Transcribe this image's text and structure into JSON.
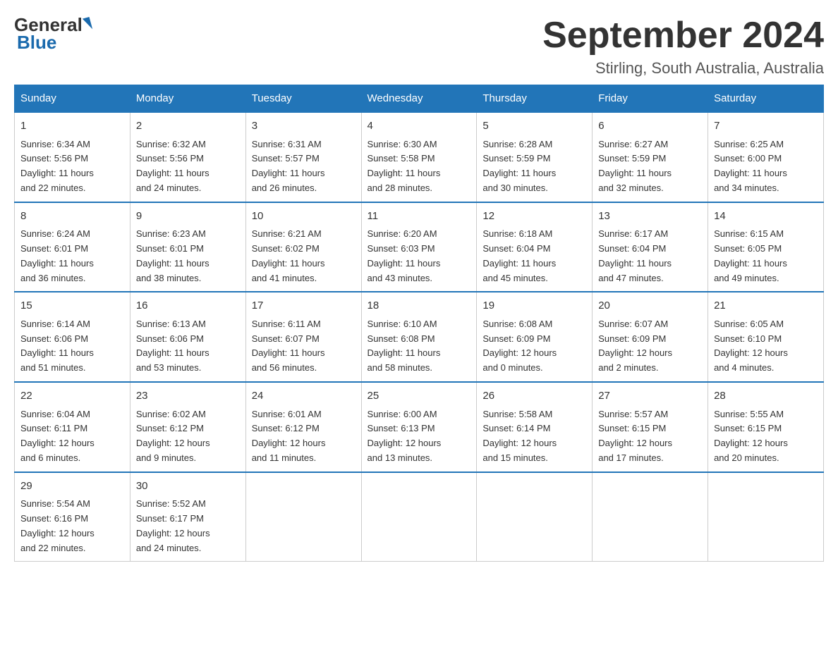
{
  "header": {
    "logo_general": "General",
    "logo_blue": "Blue",
    "month_year": "September 2024",
    "location": "Stirling, South Australia, Australia"
  },
  "days_of_week": [
    "Sunday",
    "Monday",
    "Tuesday",
    "Wednesday",
    "Thursday",
    "Friday",
    "Saturday"
  ],
  "weeks": [
    [
      {
        "day": "1",
        "sunrise": "6:34 AM",
        "sunset": "5:56 PM",
        "daylight": "11 hours and 22 minutes."
      },
      {
        "day": "2",
        "sunrise": "6:32 AM",
        "sunset": "5:56 PM",
        "daylight": "11 hours and 24 minutes."
      },
      {
        "day": "3",
        "sunrise": "6:31 AM",
        "sunset": "5:57 PM",
        "daylight": "11 hours and 26 minutes."
      },
      {
        "day": "4",
        "sunrise": "6:30 AM",
        "sunset": "5:58 PM",
        "daylight": "11 hours and 28 minutes."
      },
      {
        "day": "5",
        "sunrise": "6:28 AM",
        "sunset": "5:59 PM",
        "daylight": "11 hours and 30 minutes."
      },
      {
        "day": "6",
        "sunrise": "6:27 AM",
        "sunset": "5:59 PM",
        "daylight": "11 hours and 32 minutes."
      },
      {
        "day": "7",
        "sunrise": "6:25 AM",
        "sunset": "6:00 PM",
        "daylight": "11 hours and 34 minutes."
      }
    ],
    [
      {
        "day": "8",
        "sunrise": "6:24 AM",
        "sunset": "6:01 PM",
        "daylight": "11 hours and 36 minutes."
      },
      {
        "day": "9",
        "sunrise": "6:23 AM",
        "sunset": "6:01 PM",
        "daylight": "11 hours and 38 minutes."
      },
      {
        "day": "10",
        "sunrise": "6:21 AM",
        "sunset": "6:02 PM",
        "daylight": "11 hours and 41 minutes."
      },
      {
        "day": "11",
        "sunrise": "6:20 AM",
        "sunset": "6:03 PM",
        "daylight": "11 hours and 43 minutes."
      },
      {
        "day": "12",
        "sunrise": "6:18 AM",
        "sunset": "6:04 PM",
        "daylight": "11 hours and 45 minutes."
      },
      {
        "day": "13",
        "sunrise": "6:17 AM",
        "sunset": "6:04 PM",
        "daylight": "11 hours and 47 minutes."
      },
      {
        "day": "14",
        "sunrise": "6:15 AM",
        "sunset": "6:05 PM",
        "daylight": "11 hours and 49 minutes."
      }
    ],
    [
      {
        "day": "15",
        "sunrise": "6:14 AM",
        "sunset": "6:06 PM",
        "daylight": "11 hours and 51 minutes."
      },
      {
        "day": "16",
        "sunrise": "6:13 AM",
        "sunset": "6:06 PM",
        "daylight": "11 hours and 53 minutes."
      },
      {
        "day": "17",
        "sunrise": "6:11 AM",
        "sunset": "6:07 PM",
        "daylight": "11 hours and 56 minutes."
      },
      {
        "day": "18",
        "sunrise": "6:10 AM",
        "sunset": "6:08 PM",
        "daylight": "11 hours and 58 minutes."
      },
      {
        "day": "19",
        "sunrise": "6:08 AM",
        "sunset": "6:09 PM",
        "daylight": "12 hours and 0 minutes."
      },
      {
        "day": "20",
        "sunrise": "6:07 AM",
        "sunset": "6:09 PM",
        "daylight": "12 hours and 2 minutes."
      },
      {
        "day": "21",
        "sunrise": "6:05 AM",
        "sunset": "6:10 PM",
        "daylight": "12 hours and 4 minutes."
      }
    ],
    [
      {
        "day": "22",
        "sunrise": "6:04 AM",
        "sunset": "6:11 PM",
        "daylight": "12 hours and 6 minutes."
      },
      {
        "day": "23",
        "sunrise": "6:02 AM",
        "sunset": "6:12 PM",
        "daylight": "12 hours and 9 minutes."
      },
      {
        "day": "24",
        "sunrise": "6:01 AM",
        "sunset": "6:12 PM",
        "daylight": "12 hours and 11 minutes."
      },
      {
        "day": "25",
        "sunrise": "6:00 AM",
        "sunset": "6:13 PM",
        "daylight": "12 hours and 13 minutes."
      },
      {
        "day": "26",
        "sunrise": "5:58 AM",
        "sunset": "6:14 PM",
        "daylight": "12 hours and 15 minutes."
      },
      {
        "day": "27",
        "sunrise": "5:57 AM",
        "sunset": "6:15 PM",
        "daylight": "12 hours and 17 minutes."
      },
      {
        "day": "28",
        "sunrise": "5:55 AM",
        "sunset": "6:15 PM",
        "daylight": "12 hours and 20 minutes."
      }
    ],
    [
      {
        "day": "29",
        "sunrise": "5:54 AM",
        "sunset": "6:16 PM",
        "daylight": "12 hours and 22 minutes."
      },
      {
        "day": "30",
        "sunrise": "5:52 AM",
        "sunset": "6:17 PM",
        "daylight": "12 hours and 24 minutes."
      },
      null,
      null,
      null,
      null,
      null
    ]
  ],
  "labels": {
    "sunrise_prefix": "Sunrise: ",
    "sunset_prefix": "Sunset: ",
    "daylight_prefix": "Daylight: "
  }
}
